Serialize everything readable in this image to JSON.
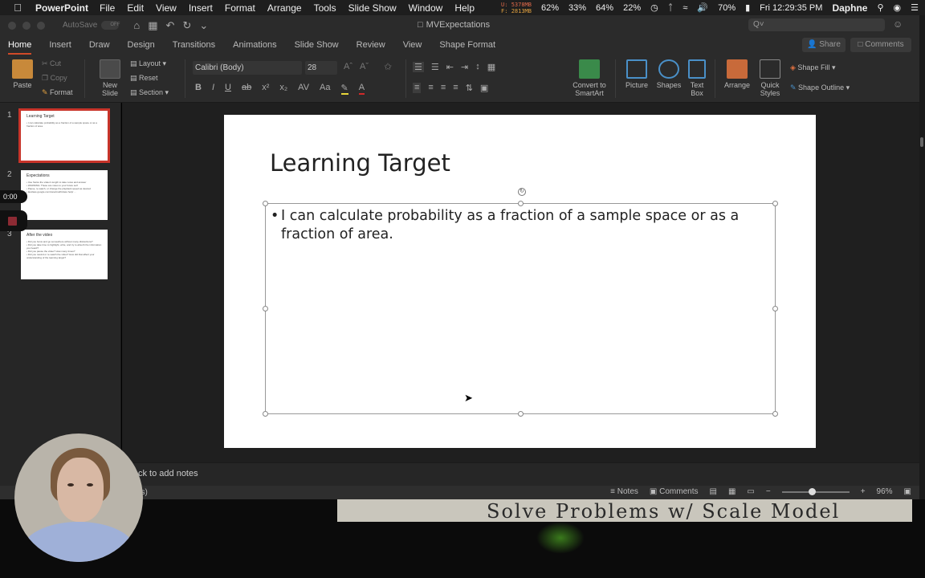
{
  "menubar": {
    "app": "PowerPoint",
    "items": [
      "File",
      "Edit",
      "View",
      "Insert",
      "Format",
      "Arrange",
      "Tools",
      "Slide Show",
      "Window",
      "Help"
    ],
    "mem_used": "U: 5378MB",
    "mem_free": "F: 2813MB",
    "stats": [
      "62%",
      "33%",
      "64%",
      "22%"
    ],
    "battery": "70%",
    "clock": "Fri 12:29:35 PM",
    "user": "Daphne"
  },
  "window": {
    "autosave": "AutoSave",
    "autosave_state": "OFF",
    "doc_title": "MVExpectations",
    "search_placeholder": "Q˅"
  },
  "ribbon_tabs": {
    "items": [
      "Home",
      "Insert",
      "Draw",
      "Design",
      "Transitions",
      "Animations",
      "Slide Show",
      "Review",
      "View",
      "Shape Format"
    ],
    "active": "Home",
    "share": "Share",
    "comments": "Comments"
  },
  "ribbon": {
    "paste": "Paste",
    "cut": "Cut",
    "copy": "Copy",
    "format": "Format",
    "new_slide": "New Slide",
    "layout": "Layout",
    "reset": "Reset",
    "section": "Section",
    "font_name": "Calibri (Body)",
    "font_size": "28",
    "convert_smartart": "Convert to SmartArt",
    "picture": "Picture",
    "shapes": "Shapes",
    "text_box": "Text Box",
    "arrange": "Arrange",
    "quick_styles": "Quick Styles",
    "shape_fill": "Shape Fill",
    "shape_outline": "Shape Outline"
  },
  "thumbnails": [
    {
      "num": "1",
      "title": "Learning Target",
      "lines": [
        "• I can calculate probability as a fraction of a sample space or as a fraction of area."
      ]
    },
    {
      "num": "2",
      "title": "Expectations",
      "lines": [
        "• Use Swiss the video's length to take notes and answer",
        "• WARNING: These are notes to your future self",
        "• Pause, re-watch, or change the playback speed as desired",
        "• lasclass.google.com/view/math/class help/ ..."
      ]
    },
    {
      "num": "3",
      "title": "After the video",
      "lines": [
        "• Did you focus and go somewhere without many distractions?",
        "• Did you take time to highlight, write, and try to absorb the information you heard?",
        "• Did you pause the video? How many times?",
        "• Did you rewind or re-watch the video? How did that affect your understanding of the learning target?"
      ]
    }
  ],
  "recording": {
    "timer": "0:00"
  },
  "slide": {
    "title": "Learning Target",
    "bullet": "I can calculate probability as a fraction of a sample space or as a fraction of area."
  },
  "notes": {
    "placeholder": "ck to add notes"
  },
  "statusbar": {
    "left": "es)",
    "notes_label": "Notes",
    "comments_label": "Comments",
    "zoom": "96%",
    "zoom_level": 0.45
  },
  "background": {
    "whiteboard_text": "Solve Problems w/ Scale Model"
  }
}
